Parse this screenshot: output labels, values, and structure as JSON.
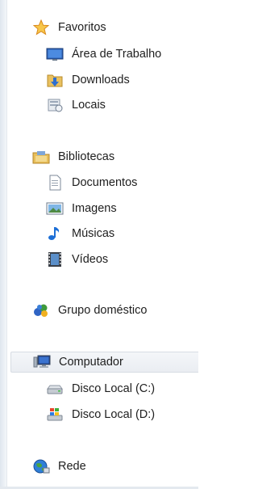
{
  "nav": {
    "favorites": {
      "label": "Favoritos",
      "items": [
        {
          "label": "Área de Trabalho",
          "icon": "desktop-icon"
        },
        {
          "label": "Downloads",
          "icon": "downloads-folder-icon"
        },
        {
          "label": "Locais",
          "icon": "recent-places-icon"
        }
      ]
    },
    "libraries": {
      "label": "Bibliotecas",
      "items": [
        {
          "label": "Documentos",
          "icon": "document-icon"
        },
        {
          "label": "Imagens",
          "icon": "pictures-icon"
        },
        {
          "label": "Músicas",
          "icon": "music-icon"
        },
        {
          "label": "Vídeos",
          "icon": "video-icon"
        }
      ]
    },
    "homegroup": {
      "label": "Grupo doméstico"
    },
    "computer": {
      "label": "Computador",
      "selected": true,
      "items": [
        {
          "label": "Disco Local (C:)",
          "icon": "drive-icon"
        },
        {
          "label": "Disco Local (D:)",
          "icon": "windows-drive-icon"
        }
      ]
    },
    "network": {
      "label": "Rede"
    }
  },
  "colors": {
    "selection_bg": "#eaedf2",
    "selection_border": "#d7dce3",
    "text": "#1e1e1e"
  }
}
